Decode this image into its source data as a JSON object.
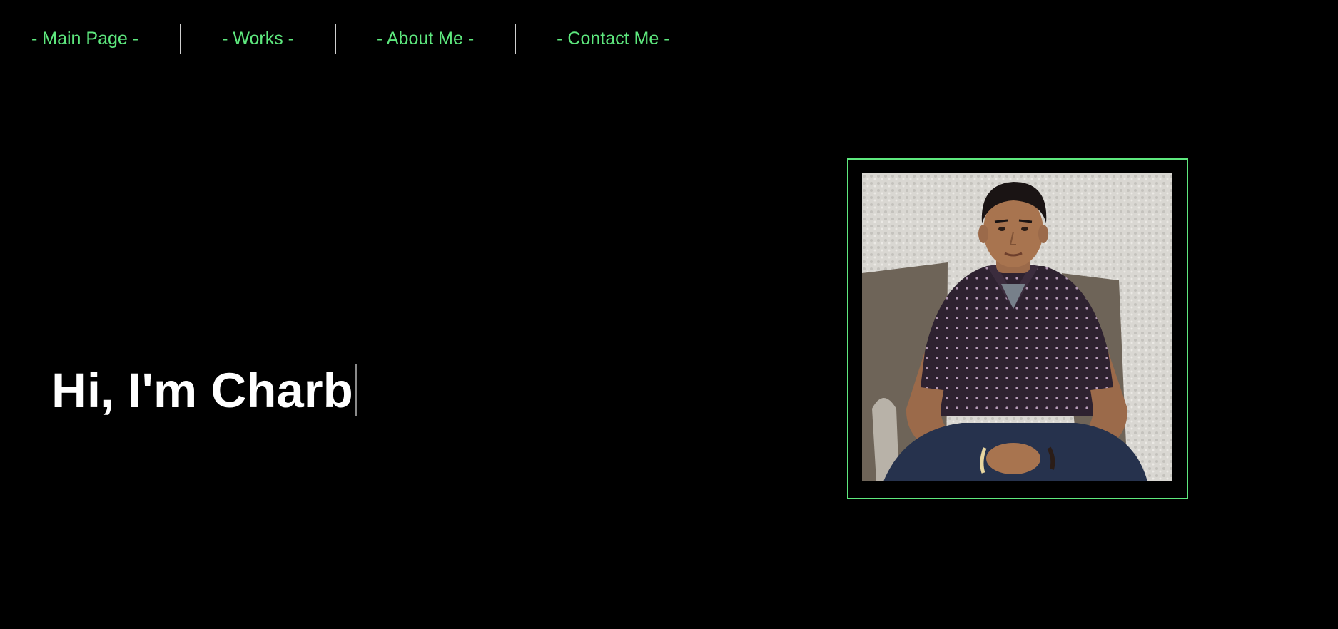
{
  "nav": {
    "items": [
      {
        "label": "- Main Page -"
      },
      {
        "label": "- Works -"
      },
      {
        "label": "- About Me -"
      },
      {
        "label": "- Contact Me -"
      }
    ],
    "link_color": "#5ee87e"
  },
  "hero": {
    "heading": "Hi, I'm Charb"
  },
  "colors": {
    "background": "#000000",
    "accent": "#5ee87e",
    "text": "#ffffff"
  }
}
